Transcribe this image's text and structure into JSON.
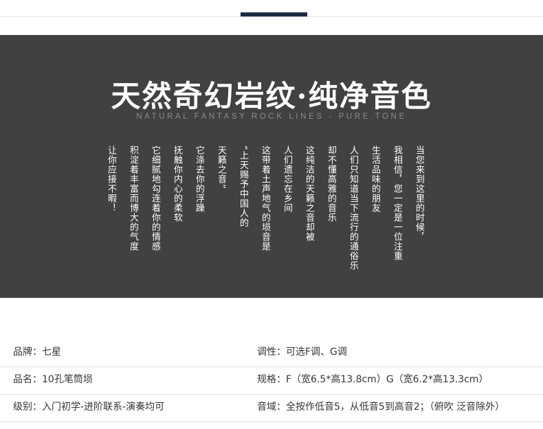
{
  "banner": {
    "title": "天然奇幻岩纹·纯净音色",
    "subtitle": "NATURAL FANTASY ROCK LINES - PURE TONE",
    "poem_columns": [
      "当您来到这里的时候，",
      "我相信，您一定是一位注重",
      "生活品味的朋友",
      "人们只知道当下流行的通俗乐",
      "却不懂高雅的音乐",
      "这纯洁的天籁之音却被",
      "人们遗忘在乡间",
      "这带着土声地气的埙音是",
      "“上天赐予中国人的",
      "天籁之音”",
      "它涤去你的浮躁",
      "抚触你内心的柔软",
      "它细腻地勾连着你的情感",
      "积淀着丰富而博大的气度",
      "让你应接不暇！"
    ]
  },
  "specs": [
    {
      "left": "品牌：七星",
      "right": "调性：可选F调、G调"
    },
    {
      "left": "品名：10孔笔筒埙",
      "right": "规格：F（宽6.5*高13.8cm）G（宽6.2*高13.3cm）"
    },
    {
      "left": "级别：入门初学-进阶联系-演奏均可",
      "right": "音域：全按作低音5，从低音5到高音2；（俯吹 泛音除外）"
    }
  ]
}
